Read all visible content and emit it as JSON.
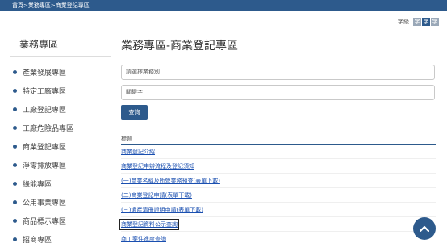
{
  "breadcrumb": {
    "home": "首頁",
    "sep1": " > ",
    "section": "業務專區",
    "sep2": " > ",
    "current": "商業登記專區"
  },
  "font_control": {
    "label": "字級",
    "small": "字",
    "medium": "字",
    "large": "字",
    "active": "medium"
  },
  "sidebar": {
    "title": "業務專區",
    "items": [
      {
        "label": "產業發展專區"
      },
      {
        "label": "特定工廠專區"
      },
      {
        "label": "工廠登記專區"
      },
      {
        "label": "工廠危險品專區"
      },
      {
        "label": "商業登記專區"
      },
      {
        "label": "淨零排放專區"
      },
      {
        "label": "綠能專區"
      },
      {
        "label": "公用事業專區"
      },
      {
        "label": "商品標示專區"
      },
      {
        "label": "招商專區"
      }
    ]
  },
  "main": {
    "title": "業務專區-商業登記專區",
    "category_select": {
      "value": "請選擇業務別"
    },
    "keyword_input": {
      "placeholder": "關鍵字"
    },
    "search_button": "查詢",
    "results_header": "標題",
    "results": [
      {
        "label": "商業登記介紹"
      },
      {
        "label": "商業登記申辦流程及登記須知"
      },
      {
        "label": "(一)商業名稱及所營業務預查(表單下載)"
      },
      {
        "label": "(二)商業登記申請(表單下載)"
      },
      {
        "label": "(三)遺產清冊證明申請(表單下載)"
      },
      {
        "label": "商業登記資料公示查詢"
      },
      {
        "label": "商工案件進度查詢"
      }
    ],
    "focused_index": 5
  },
  "colors": {
    "primary": "#2d5a8c",
    "link": "#1a4fb0"
  },
  "icons": {
    "back_to_top": "chevron-up-icon",
    "bullet": "dot-icon"
  }
}
